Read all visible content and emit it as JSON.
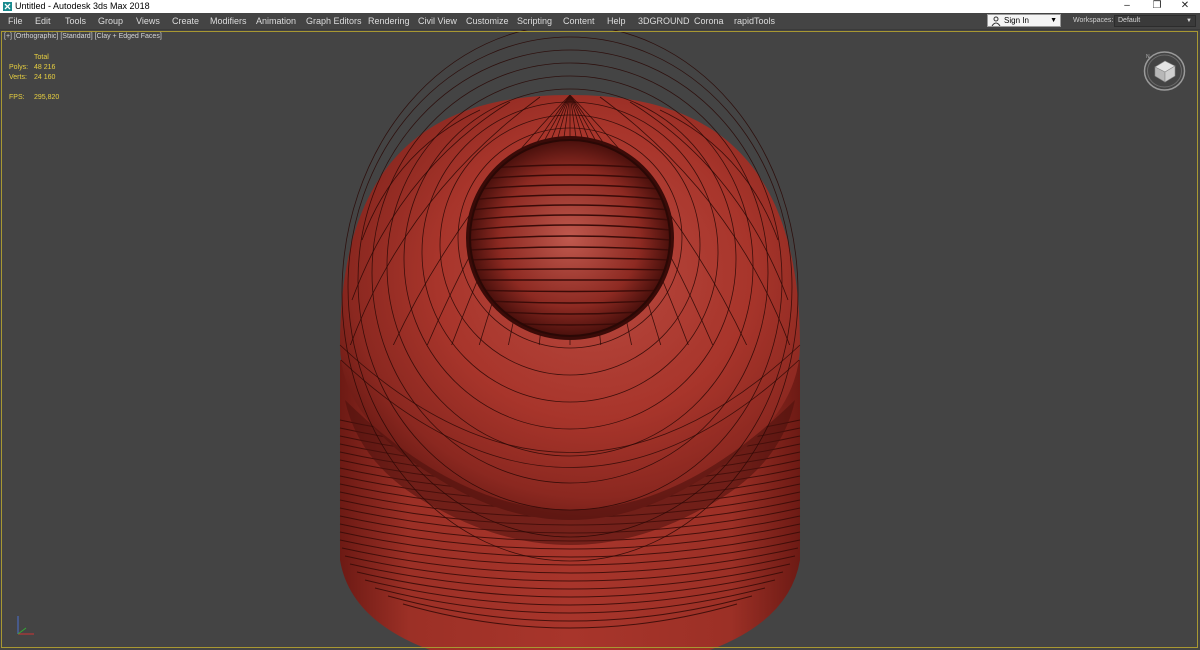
{
  "window": {
    "title": "Untitled - Autodesk 3ds Max 2018",
    "minimize_glyph": "–",
    "restore_glyph": "❐",
    "close_glyph": "✕"
  },
  "menu": {
    "items": [
      {
        "label": "File"
      },
      {
        "label": "Edit"
      },
      {
        "label": "Tools"
      },
      {
        "label": "Group"
      },
      {
        "label": "Views"
      },
      {
        "label": "Create"
      },
      {
        "label": "Modifiers"
      },
      {
        "label": "Animation"
      },
      {
        "label": "Graph Editors"
      },
      {
        "label": "Rendering"
      },
      {
        "label": "Civil View"
      },
      {
        "label": "Customize"
      },
      {
        "label": "Scripting"
      },
      {
        "label": "Content"
      },
      {
        "label": "Help"
      },
      {
        "label": "3DGROUND"
      },
      {
        "label": "Corona"
      },
      {
        "label": "rapidTools"
      }
    ]
  },
  "account": {
    "sign_in_label": "Sign In",
    "workspaces_label": "Workspaces:",
    "workspace_value": "Default"
  },
  "viewport": {
    "label_plus": "[+]",
    "label_view": "[Orthographic]",
    "label_shading_mode": "[Standard]",
    "label_shading": "[Clay + Edged Faces]",
    "stats": {
      "header": "Total",
      "polys_label": "Polys:",
      "polys_value": "48 216",
      "verts_label": "Verts:",
      "verts_value": "24 160",
      "fps_label": "FPS:",
      "fps_value": "295,820"
    }
  },
  "colors": {
    "model_fill": "#a8352b",
    "model_dark": "#5a1410",
    "wire": "#2a0805",
    "stats_text": "#e8d040",
    "viewport_bg": "#444444"
  }
}
